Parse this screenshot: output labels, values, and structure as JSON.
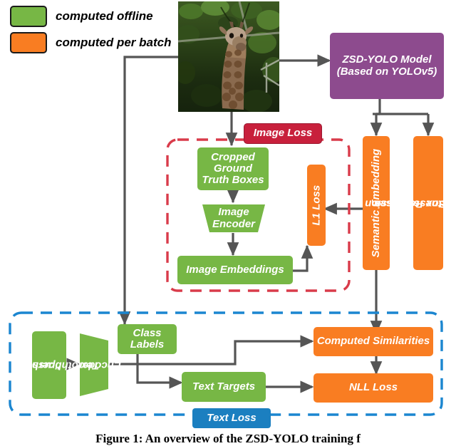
{
  "figure": {
    "caption": "Figure 1: An overview of the ZSD-YOLO training f"
  },
  "legend": {
    "items": [
      {
        "label": "computed offline",
        "color": "#77b745"
      },
      {
        "label": "computed per batch",
        "color": "#f97d22"
      }
    ]
  },
  "colors": {
    "green": "#77b745",
    "orange": "#f97d22",
    "purple": "#8d4b8e",
    "red": "#c8203c",
    "blue": "#1b7fc0",
    "arrow": "#555555",
    "image_loss_dash": "#d93b4a",
    "text_loss_dash": "#1b86d0"
  },
  "nodes": {
    "input_image": "input-giraffe-photo",
    "model": "ZSD-YOLO Model\n(Based on YOLOv5)",
    "model_line1": "ZSD-YOLO Model",
    "model_line2": "(Based on YOLOv5)",
    "cropped_boxes_l1": "Cropped",
    "cropped_boxes_l2": "Ground",
    "cropped_boxes_l3": "Truth Boxes",
    "image_encoder_l1": "Image",
    "image_encoder_l2": "Encoder",
    "image_embeddings": "Image Embeddings",
    "l1_loss": "L1 Loss",
    "semantic_embedding": "Semantic Embedding",
    "yolo_losses_l1": "YOLO Box Regression",
    "yolo_losses_l2": "and Objectness Losses",
    "class_labels_l1": "Class",
    "class_labels_l2": "Labels",
    "text_prompt_l1": "\"person\"",
    "text_prompt_l2": "...",
    "text_prompt_l3": "\"toothbrush\"",
    "text_encoder_l1": "Text",
    "text_encoder_l2": "Encoder",
    "text_targets": "Text Targets",
    "computed_similarities": "Computed Similarities",
    "nll_loss": "NLL Loss"
  },
  "group_labels": {
    "image_loss": "Image Loss",
    "text_loss": "Text Loss"
  }
}
